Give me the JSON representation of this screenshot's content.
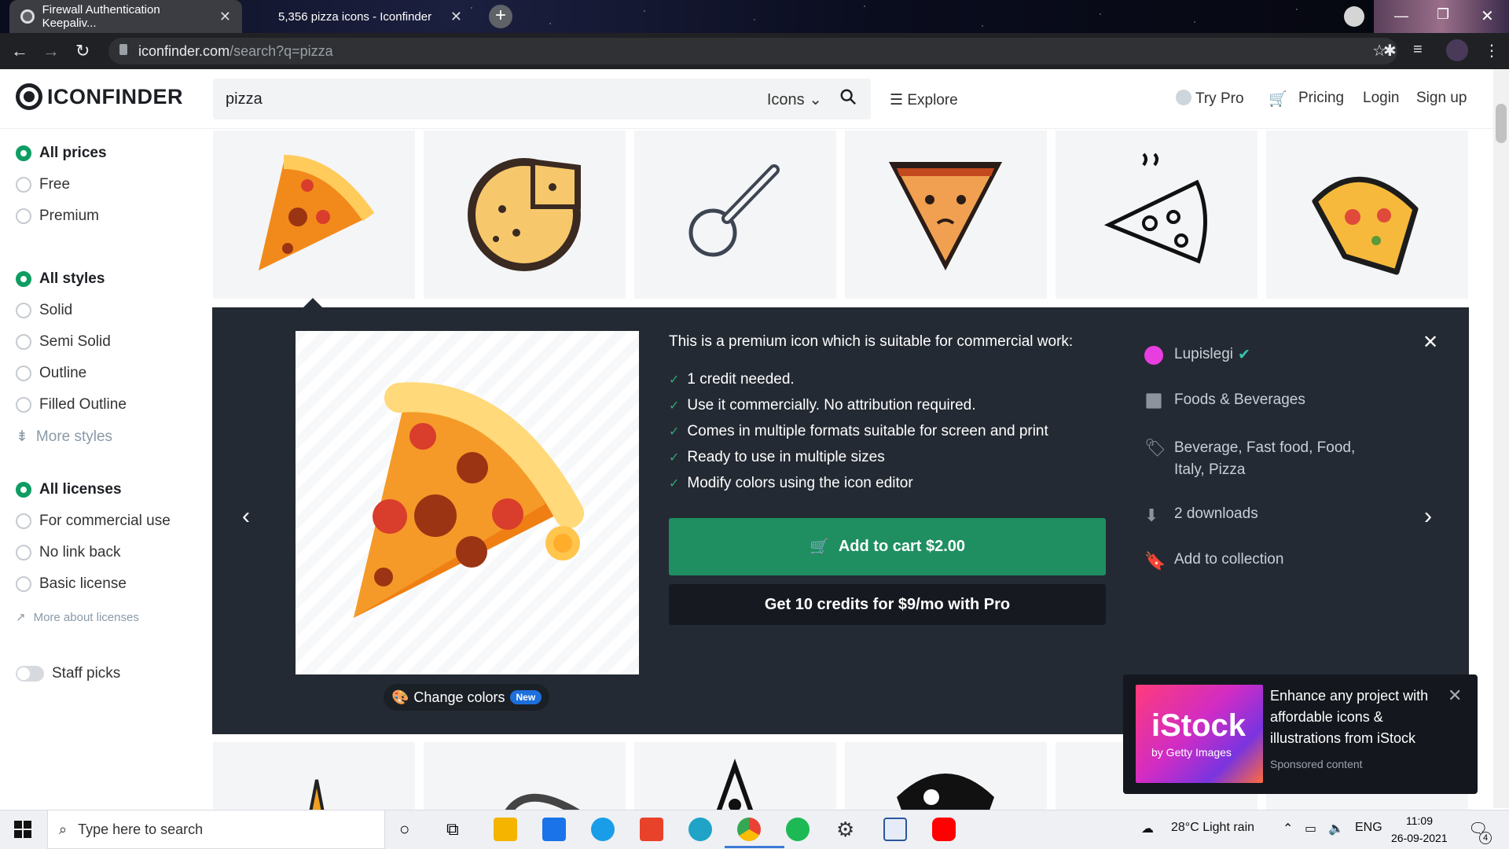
{
  "browser": {
    "tabs": [
      {
        "title": "Firewall Authentication Keepaliv...",
        "active": true
      },
      {
        "title": "5,356 pizza icons - Iconfinder",
        "active": false
      }
    ],
    "url_domain": "iconfinder.com",
    "url_path": "/search?q=pizza"
  },
  "header": {
    "logo": "ICONFINDER",
    "search_value": "pizza",
    "search_type": "Icons",
    "explore": "Explore",
    "try_pro": "Try Pro",
    "pricing": "Pricing",
    "login": "Login",
    "signup": "Sign up"
  },
  "sidebar": {
    "prices": [
      "All prices",
      "Free",
      "Premium"
    ],
    "styles": [
      "All styles",
      "Solid",
      "Semi Solid",
      "Outline",
      "Filled Outline"
    ],
    "more_styles": "More styles",
    "licenses": [
      "All licenses",
      "For commercial use",
      "No link back",
      "Basic license"
    ],
    "more_licenses": "More about licenses",
    "staff_picks": "Staff picks"
  },
  "detail": {
    "headline": "This is a premium icon which is suitable for commercial work:",
    "features": [
      "1 credit needed.",
      "Use it commercially. No attribution required.",
      "Comes in multiple formats suitable for screen and print",
      "Ready to use in multiple sizes",
      "Modify colors using the "
    ],
    "icon_editor_link": "icon editor",
    "add_to_cart": "Add to cart $2.00",
    "pro_offer": "Get 10 credits for $9/mo with Pro",
    "change_colors": "Change colors",
    "new_badge": "New",
    "author": "Lupislegi",
    "category": "Foods & Beverages",
    "tags_line1": "Beverage, Fast food, Food,",
    "tags_line2": "Italy, Pizza",
    "downloads": "2 downloads",
    "add_collection": "Add to collection"
  },
  "ad": {
    "image_text": "iStock",
    "image_sub": "by Getty Images",
    "title": "Enhance any project with affordable icons & illustrations from iStock",
    "sponsored": "Sponsored content"
  },
  "taskbar": {
    "search_placeholder": "Type here to search",
    "weather": "28°C  Light rain",
    "lang": "ENG",
    "time": "11:09",
    "date": "26-09-2021",
    "notif_count": "4"
  },
  "colors": {
    "accent_green": "#1f8f61",
    "panel_dark": "#242a33"
  }
}
